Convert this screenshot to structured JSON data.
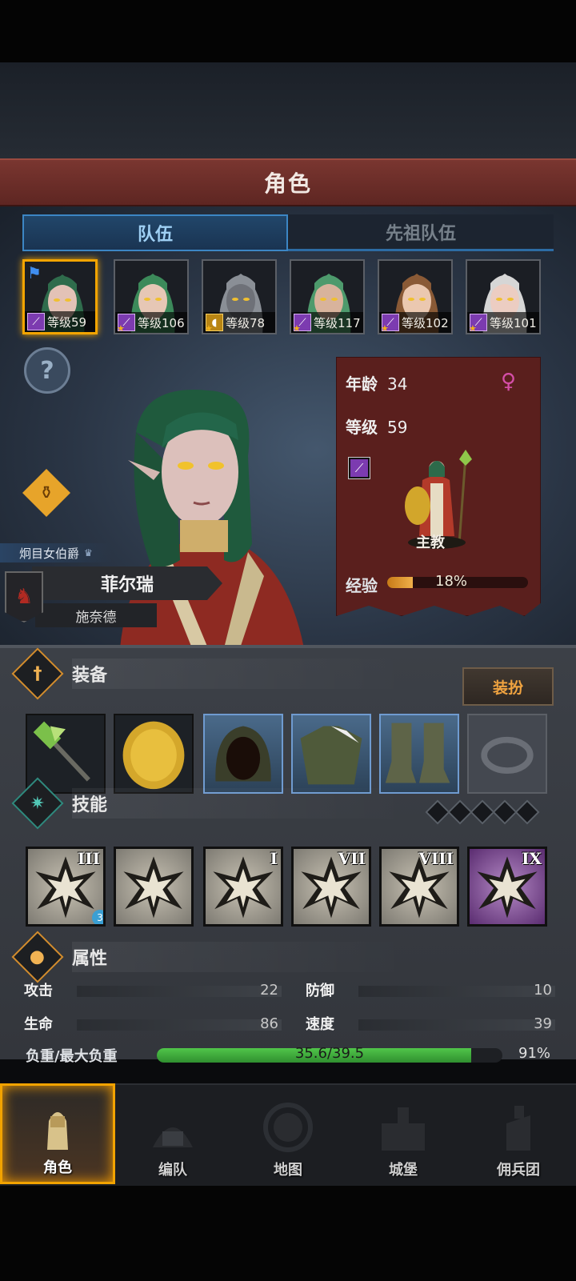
{
  "header": {
    "title": "角色"
  },
  "tabs": [
    {
      "label": "队伍",
      "active": true
    },
    {
      "label": "先祖队伍",
      "active": false
    }
  ],
  "party": [
    {
      "level_label": "等级59",
      "class_icon": "staff-icon",
      "selected": true,
      "leader": true,
      "hair": "#2f6c4c",
      "skin": "#e3c2b6"
    },
    {
      "level_label": "等级106",
      "class_icon": "staff-icon",
      "selected": false,
      "hair": "#3c8a5a",
      "skin": "#e6c7b5"
    },
    {
      "level_label": "等级78",
      "class_icon": "shield-icon",
      "selected": false,
      "hair": "#8a8f96",
      "skin": "#6e7178"
    },
    {
      "level_label": "等级117",
      "class_icon": "staff-icon",
      "selected": false,
      "hair": "#4d9a6c",
      "skin": "#d8b39c"
    },
    {
      "level_label": "等级102",
      "class_icon": "staff-icon",
      "selected": false,
      "hair": "#8a5a36",
      "skin": "#ebc8b0"
    },
    {
      "level_label": "等级101",
      "class_icon": "staff-icon",
      "selected": false,
      "hair": "#d6d6d6",
      "skin": "#eccdc2"
    }
  ],
  "character": {
    "title": "炯目女伯爵",
    "name": "菲尔瑞",
    "surname": "施奈德",
    "age_label": "年龄",
    "age": "34",
    "level_label": "等级",
    "level": "59",
    "class_name": "主教",
    "exp_label": "经验",
    "exp_percent": "18%",
    "exp_fraction": 0.18
  },
  "equipment": {
    "section_title": "装备",
    "dress_button": "装扮",
    "slots": [
      {
        "icon": "staff-icon",
        "style": "normal"
      },
      {
        "icon": "round-shield-icon",
        "style": "normal"
      },
      {
        "icon": "hood-icon",
        "style": "blue"
      },
      {
        "icon": "robe-icon",
        "style": "blue"
      },
      {
        "icon": "boots-icon",
        "style": "blue"
      },
      {
        "icon": "ring-icon",
        "style": "empty"
      }
    ]
  },
  "skills": {
    "section_title": "技能",
    "slots": [
      {
        "rank": "III",
        "icon": "drain-crystal-icon",
        "badge": "3",
        "style": "normal"
      },
      {
        "rank": "",
        "icon": "meditate-crystal-icon",
        "badge": "",
        "style": "normal"
      },
      {
        "rank": "I",
        "icon": "crystal-hand-icon",
        "badge": "",
        "style": "normal"
      },
      {
        "rank": "VII",
        "icon": "burst-icon",
        "badge": "",
        "style": "normal"
      },
      {
        "rank": "VIII",
        "icon": "explosion-icon",
        "badge": "",
        "style": "normal"
      },
      {
        "rank": "IX",
        "icon": "explosion-icon",
        "badge": "",
        "style": "purple"
      }
    ]
  },
  "attributes": {
    "section_title": "属性",
    "attack_label": "攻击",
    "attack": "22",
    "defense_label": "防御",
    "defense": "10",
    "hp_label": "生命",
    "hp": "86",
    "speed_label": "速度",
    "speed": "39",
    "load_label": "负重/最大负重",
    "load": "35.6/39.5",
    "load_percent": "91%",
    "load_fraction": 0.91
  },
  "nav": [
    {
      "label": "角色",
      "icon": "knight-icon",
      "active": true
    },
    {
      "label": "编队",
      "icon": "formation-icon",
      "active": false
    },
    {
      "label": "地图",
      "icon": "compass-map-icon",
      "active": false
    },
    {
      "label": "城堡",
      "icon": "castle-icon",
      "active": false
    },
    {
      "label": "佣兵团",
      "icon": "mercenary-icon",
      "active": false
    }
  ],
  "colors": {
    "accent": "#f2a300",
    "banner": "#6b2b26",
    "exp": "#e3951f",
    "load": "#45b43f",
    "class_purple": "#7c3bb0"
  }
}
